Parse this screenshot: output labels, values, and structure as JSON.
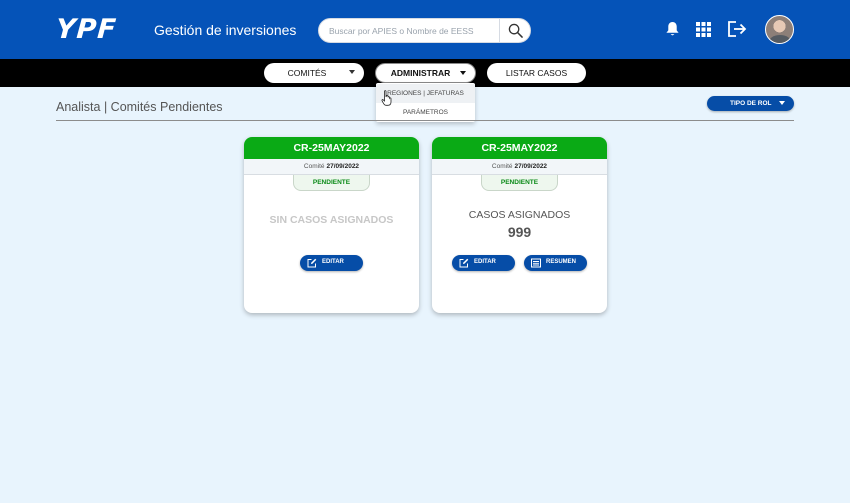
{
  "header": {
    "logo_text": "YPF",
    "app_title": "Gestión de inversiones",
    "search_placeholder": "Buscar por APIES o Nombre de EESS",
    "icons": [
      "bell-icon",
      "apps-grid-icon",
      "logout-icon",
      "user-avatar"
    ]
  },
  "nav": {
    "items": [
      {
        "label": "Comités",
        "has_caret": true
      },
      {
        "label": "Administrar",
        "has_caret": true,
        "active": true
      },
      {
        "label": "Listar casos",
        "has_caret": false
      }
    ],
    "dropdown": [
      {
        "label": "Regiones | Jefaturas",
        "hover": true
      },
      {
        "label": "Parámetros",
        "hover": false
      }
    ]
  },
  "page": {
    "title": "Analista | Comités Pendientes",
    "role_button": "Tipo de rol"
  },
  "cards": [
    {
      "code": "CR-25MAY2022",
      "committee_label": "Comité",
      "committee_date": "27/09/2022",
      "status": "Pendiente",
      "empty_text": "SIN CASOS ASIGNADOS",
      "edit_label": "Editar"
    },
    {
      "code": "CR-25MAY2022",
      "committee_label": "Comité",
      "committee_date": "27/09/2022",
      "status": "Pendiente",
      "cases_label": "CASOS ASIGNADOS",
      "cases_count": "999",
      "edit_label": "Editar",
      "summary_label": "Resumen"
    }
  ],
  "colors": {
    "header_blue": "#0553b8",
    "button_blue": "#064da7",
    "card_green": "#0aaa15",
    "background": "#e8f4fd"
  }
}
